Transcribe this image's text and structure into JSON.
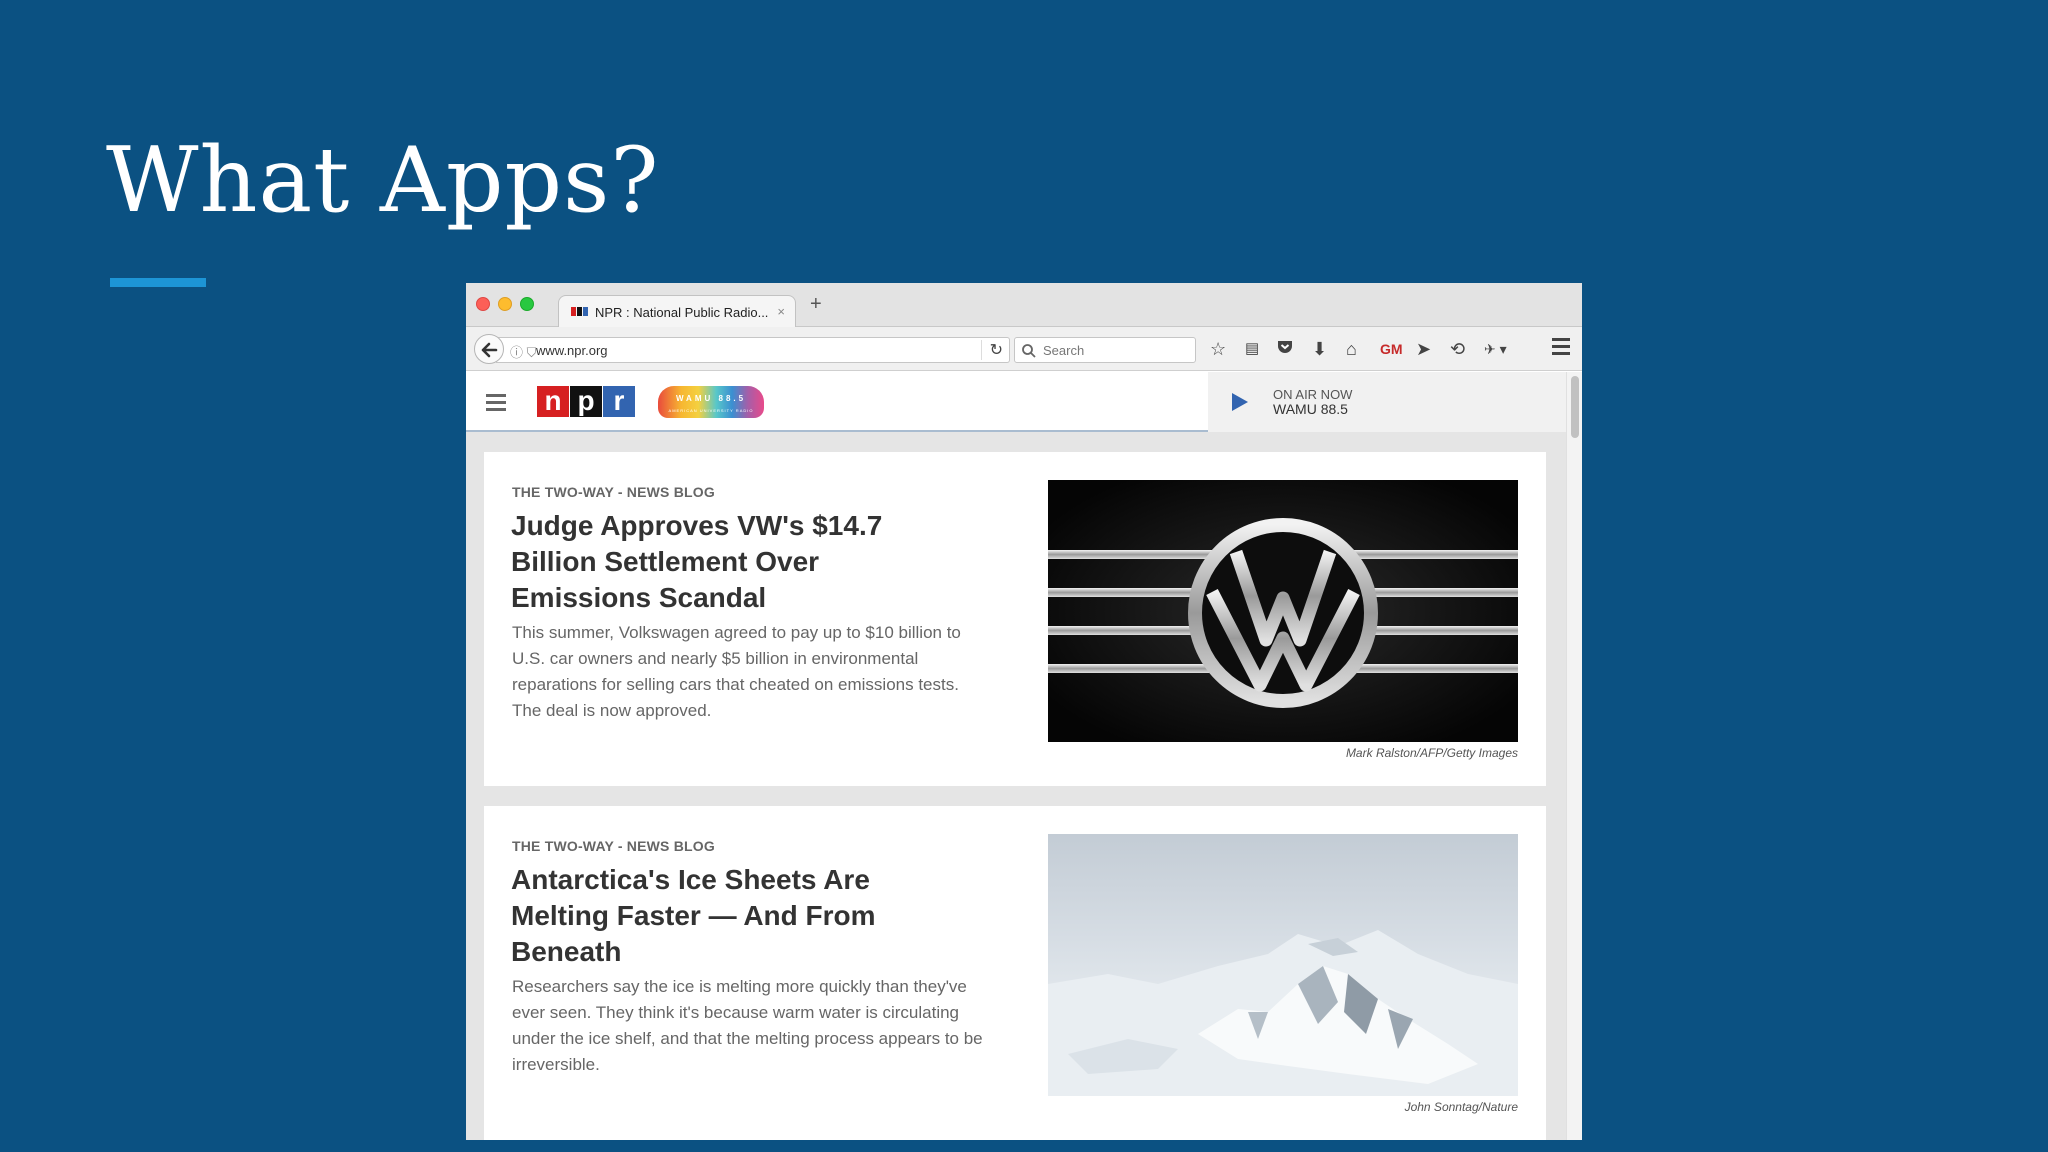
{
  "slide": {
    "title": "What Apps?"
  },
  "browser": {
    "tab_title": "NPR : National Public Radio...",
    "tab_close": "×",
    "new_tab": "+",
    "url": "www.npr.org",
    "search_placeholder": "Search"
  },
  "npr": {
    "logo_letters": [
      "n",
      "p",
      "r"
    ],
    "logo_colors": [
      "#d62021",
      "#111111",
      "#3264b0"
    ],
    "wamu_logo_text": "WAMU 88.5",
    "wamu_logo_subtext": "AMERICAN UNIVERSITY RADIO",
    "onair_label": "ON AIR NOW",
    "onair_station": "WAMU 88.5"
  },
  "articles": [
    {
      "slug": "THE TWO-WAY - NEWS BLOG",
      "headline": "Judge Approves VW's $14.7 Billion Settlement Over Emissions Scandal",
      "teaser": "This summer, Volkswagen agreed to pay up to $10 billion to U.S. car owners and nearly $5 billion in environmental reparations for selling cars that cheated on emissions tests. The deal is now approved.",
      "credit": "Mark Ralston/AFP/Getty Images"
    },
    {
      "slug": "THE TWO-WAY - NEWS BLOG",
      "headline": "Antarctica's Ice Sheets Are Melting Faster — And From Beneath",
      "teaser": "Researchers say the ice is melting more quickly than they've ever seen. They think it's because warm water is circulating under the ice shelf, and that the melting process appears to be irreversible.",
      "credit": "John Sonntag/Nature"
    }
  ]
}
